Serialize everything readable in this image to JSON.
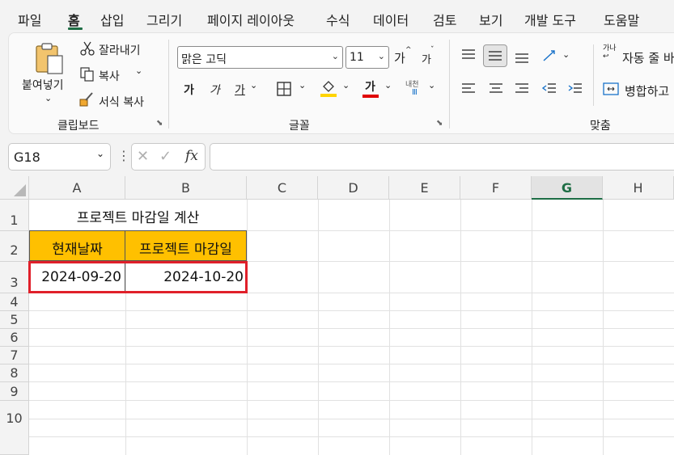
{
  "menu": {
    "items": [
      "파일",
      "홈",
      "삽입",
      "그리기",
      "페이지 레이아웃",
      "수식",
      "데이터",
      "검토",
      "보기",
      "개발 도구",
      "도움말"
    ],
    "active": "홈"
  },
  "clipboard": {
    "paste_label": "붙여넣기",
    "cut_label": "잘라내기",
    "copy_label": "복사",
    "format_painter_label": "서식 복사",
    "group_label": "클립보드"
  },
  "font": {
    "font_name": "맑은 고딕",
    "font_size": "11",
    "grow_label": "가",
    "shrink_label": "가",
    "bold_label": "가",
    "italic_label": "가",
    "underline_label": "가",
    "font_color_label": "가",
    "phonetic_label": "내천",
    "group_label": "글꼴"
  },
  "alignment": {
    "wrap_label": "자동 줄 바",
    "merge_label": "병합하고",
    "group_label": "맞춤"
  },
  "formula_bar": {
    "name_box": "G18",
    "fx_label": "fx",
    "formula": ""
  },
  "sheet": {
    "columns": [
      "A",
      "B",
      "C",
      "D",
      "E",
      "F",
      "G",
      "H"
    ],
    "selected_column": "G",
    "rows": [
      "1",
      "2",
      "3",
      "4",
      "5",
      "6",
      "7",
      "8",
      "9",
      "10"
    ],
    "title": "프로젝트 마감일 계산",
    "header_a": "현재날짜",
    "header_b": "프로젝트 마감일",
    "value_a3": "2024-09-20",
    "value_b3": "2024-10-20"
  },
  "colors": {
    "header_fill": "#ffc000",
    "highlight_border": "#e0202a",
    "accent": "#1e6e45",
    "fill_color_bar": "#ffd400",
    "font_color_bar": "#e00000"
  }
}
